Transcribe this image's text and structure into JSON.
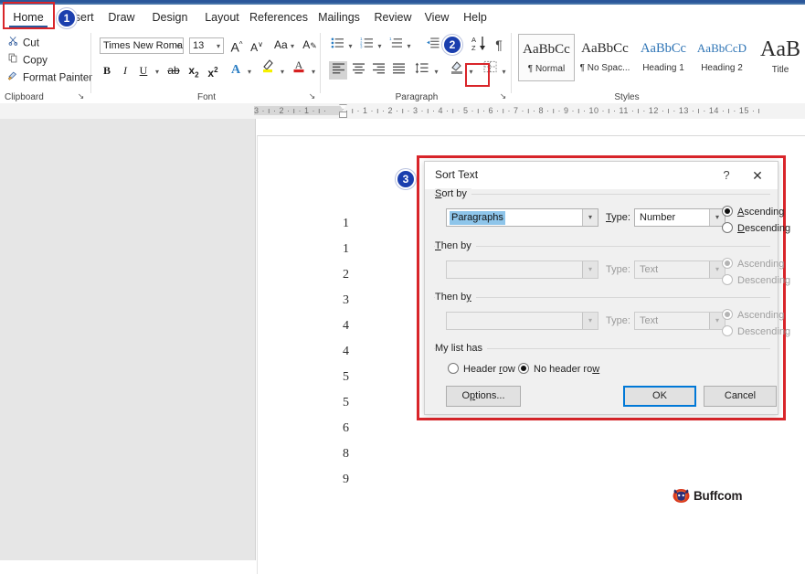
{
  "app": {
    "accent_blue": "#2b579a",
    "highlight_red": "#d9252a",
    "badge_blue": "#1b3fae"
  },
  "ribbon": {
    "tabs": [
      {
        "label": "Home",
        "active": true
      },
      {
        "label": "Insert",
        "active": false
      },
      {
        "label": "Draw",
        "active": false
      },
      {
        "label": "Design",
        "active": false
      },
      {
        "label": "Layout",
        "active": false
      },
      {
        "label": "References",
        "active": false
      },
      {
        "label": "Mailings",
        "active": false
      },
      {
        "label": "Review",
        "active": false
      },
      {
        "label": "View",
        "active": false
      },
      {
        "label": "Help",
        "active": false
      }
    ],
    "groups": {
      "clipboard": {
        "label": "Clipboard",
        "items": [
          {
            "label": "Cut",
            "icon": "scissors-icon"
          },
          {
            "label": "Copy",
            "icon": "copy-icon"
          },
          {
            "label": "Format Painter",
            "icon": "format-painter-icon"
          }
        ],
        "launcher": "↘"
      },
      "font": {
        "label": "Font",
        "font_name": "Times New Roman",
        "font_size": "13",
        "buttons": [
          {
            "label": "A",
            "name": "grow-font-icon"
          },
          {
            "label": "A",
            "name": "shrink-font-icon"
          },
          {
            "label": "Aa",
            "name": "change-case-icon"
          },
          {
            "label": "A",
            "name": "clear-formatting-icon"
          },
          {
            "label": "B",
            "name": "bold-icon"
          },
          {
            "label": "I",
            "name": "italic-icon"
          },
          {
            "label": "U",
            "name": "underline-icon"
          },
          {
            "label": "ab",
            "name": "strikethrough-icon"
          },
          {
            "label": "x",
            "name": "subscript-icon"
          },
          {
            "label": "x",
            "name": "superscript-icon"
          },
          {
            "label": "A",
            "name": "text-effects-icon"
          },
          {
            "label": "✎",
            "name": "text-highlight-color-icon"
          },
          {
            "label": "A",
            "name": "font-color-icon"
          }
        ],
        "launcher": "↘"
      },
      "paragraph": {
        "label": "Paragraph",
        "launcher": "↘",
        "sort_button_tooltip": "Sort",
        "pilcrow": "¶"
      },
      "styles": {
        "label": "Styles",
        "cards": [
          {
            "preview": "AaBbCc",
            "name": "¶ Normal",
            "selected": true,
            "kind": "normal"
          },
          {
            "preview": "AaBbCc",
            "name": "¶ No Spac...",
            "selected": false,
            "kind": "normal"
          },
          {
            "preview": "AaBbCc",
            "name": "Heading 1",
            "selected": false,
            "kind": "h1"
          },
          {
            "preview": "AaBbCcD",
            "name": "Heading 2",
            "selected": false,
            "kind": "h2"
          },
          {
            "preview": "AaB",
            "name": "Title",
            "selected": false,
            "kind": "title"
          }
        ]
      }
    }
  },
  "ruler": {
    "left_ticks": "3  ·  ı  ·  2  ·  ı  ·  1  ·  ı  ·",
    "right_ticks": "·  ı  ·  1  ·  ı  ·  2  ·  ı  ·  3  ·  ı  ·  4  ·  ı  ·  5  ·  ı  ·  6  ·  ı  ·  7  ·  ı  ·  8  ·  ı  ·  9  ·  ı  · 10 ·  ı  · 11 ·  ı  · 12 ·  ı  · 13 ·  ı  · 14 ·  ı  · 15 ·  ı"
  },
  "document": {
    "lines": [
      "1",
      "1",
      "2",
      "3",
      "4",
      "4",
      "5",
      "5",
      "6",
      "8",
      "9"
    ]
  },
  "watermark": {
    "text": "Buffcom",
    "logo": "buffalo-head-logo"
  },
  "dialog": {
    "title": "Sort Text",
    "help_glyph": "?",
    "close_glyph": "✕",
    "sort_by": {
      "legend": "Sort by",
      "legend_prefix": "S",
      "legend_rest": "ort by",
      "field_value": "Paragraphs",
      "type_label": "Type:",
      "type_value": "Number",
      "ascending_label": "Ascending",
      "descending_label": "Descending",
      "ascending_checked": true,
      "descending_checked": false
    },
    "then_by_1": {
      "legend": "Then by",
      "legend_prefix": "T",
      "legend_rest": "hen by",
      "field_value": "",
      "type_label": "Type:",
      "type_value": "Text",
      "ascending_label": "Ascending",
      "descending_label": "Descending",
      "ascending_checked": true,
      "descending_checked": false,
      "disabled": true
    },
    "then_by_2": {
      "legend": "Then by",
      "legend_prefix": "Then b",
      "legend_rest": "y",
      "field_value": "",
      "type_label": "Type:",
      "type_value": "Text",
      "ascending_label": "Ascending",
      "descending_label": "Descending",
      "ascending_checked": true,
      "descending_checked": false,
      "disabled": true
    },
    "my_list_has": {
      "legend": "My list has",
      "header_row_label": "Header row",
      "no_header_row_label": "No header row",
      "header_row_checked": false,
      "no_header_row_checked": true
    },
    "buttons": {
      "options": "Options...",
      "ok": "OK",
      "cancel": "Cancel"
    }
  },
  "badges": [
    {
      "number": "1"
    },
    {
      "number": "2"
    },
    {
      "number": "3"
    }
  ]
}
